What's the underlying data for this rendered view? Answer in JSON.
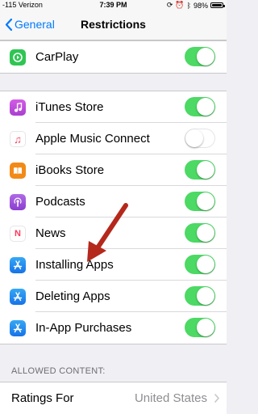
{
  "status_bar": {
    "carrier": "-115 Verizon",
    "time": "7:39 PM",
    "battery": "98%"
  },
  "nav": {
    "back_label": "General",
    "title": "Restrictions"
  },
  "rows_top": [
    {
      "label": "CarPlay",
      "icon": "carplay-icon",
      "icon_color": "#2fc553",
      "on": true
    }
  ],
  "rows_main": [
    {
      "label": "iTunes Store",
      "icon": "itunes-store-icon",
      "icon_color": "#c255d8",
      "on": true
    },
    {
      "label": "Apple Music Connect",
      "icon": "apple-music-icon",
      "icon_color": "#ffffff",
      "on": false
    },
    {
      "label": "iBooks Store",
      "icon": "ibooks-icon",
      "icon_color": "#f28a18",
      "on": true
    },
    {
      "label": "Podcasts",
      "icon": "podcasts-icon",
      "icon_color": "#9b4bd6",
      "on": true
    },
    {
      "label": "News",
      "icon": "news-icon",
      "icon_color": "#ffffff",
      "on": true
    },
    {
      "label": "Installing Apps",
      "icon": "app-store-icon",
      "icon_color": "#1e8ff0",
      "on": true
    },
    {
      "label": "Deleting Apps",
      "icon": "app-store-icon",
      "icon_color": "#1e8ff0",
      "on": true
    },
    {
      "label": "In-App Purchases",
      "icon": "app-store-icon",
      "icon_color": "#1e8ff0",
      "on": true
    }
  ],
  "allowed_content": {
    "header": "ALLOWED CONTENT:",
    "ratings_label": "Ratings For",
    "ratings_value": "United States"
  },
  "colors": {
    "accent": "#007aff",
    "toggle_on": "#4cd964",
    "arrow": "#c0392b"
  }
}
